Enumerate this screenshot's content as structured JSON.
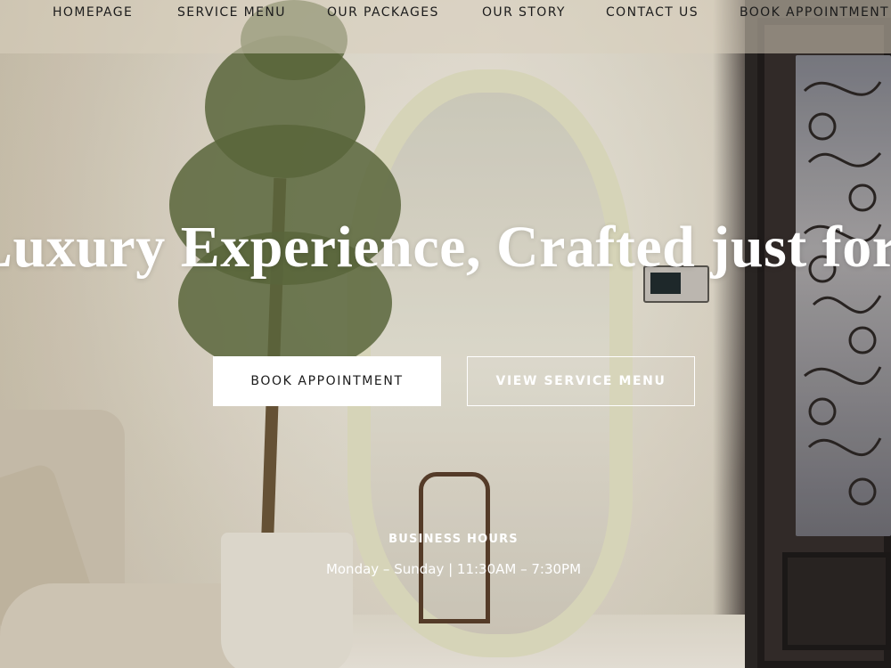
{
  "nav": {
    "items": [
      {
        "label": "HOMEPAGE"
      },
      {
        "label": "SERVICE MENU"
      },
      {
        "label": "OUR PACKAGES"
      },
      {
        "label": "OUR STORY"
      },
      {
        "label": "CONTACT US"
      },
      {
        "label": "BOOK APPOINTMENT"
      }
    ]
  },
  "hero": {
    "headline": "Luxury Experience, Crafted just for you",
    "primary_button": "BOOK APPOINTMENT",
    "secondary_button": "VIEW SERVICE MENU",
    "hours_title": "BUSINESS HOURS",
    "hours_text": "Monday – Sunday | 11:30AM – 7:30PM"
  },
  "colors": {
    "text_light": "#ffffff",
    "nav_text": "#1c1c1c",
    "button_primary_bg": "#ffffff"
  }
}
